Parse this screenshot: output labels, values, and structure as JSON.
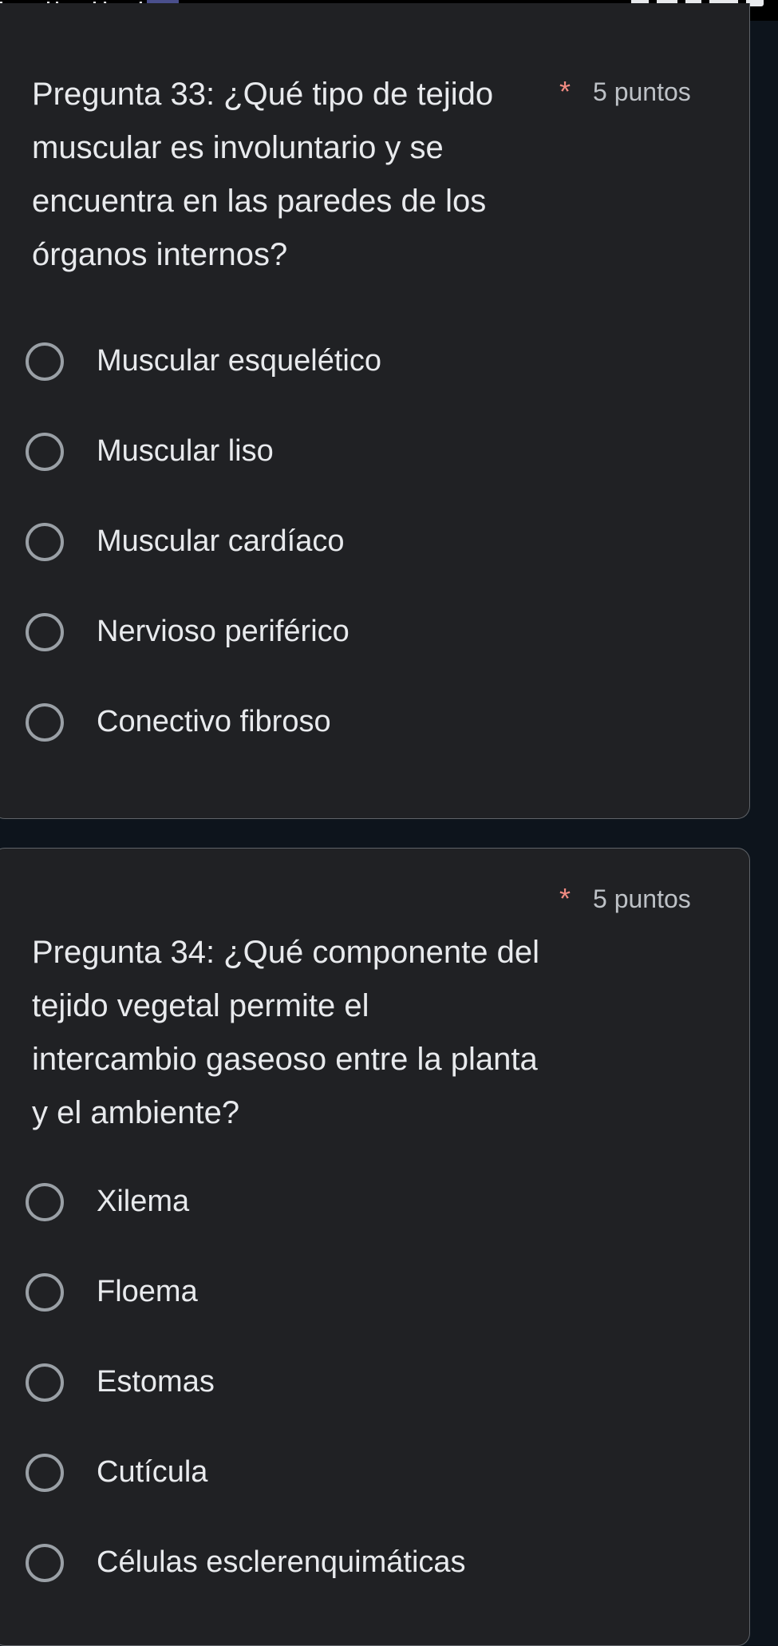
{
  "questions": [
    {
      "title": "Pregunta 33: ¿Qué tipo de tejido muscular es involuntario y se encuentra en las paredes de los órganos internos?",
      "required_mark": "*",
      "points": "5 puntos",
      "options": [
        "Muscular esquelético",
        "Muscular liso",
        "Muscular cardíaco",
        "Nervioso periférico",
        "Conectivo fibroso"
      ]
    },
    {
      "title": "Pregunta 34: ¿Qué componente del tejido vegetal permite el intercambio gaseoso entre la planta y el ambiente?",
      "required_mark": "*",
      "points": "5 puntos",
      "options": [
        "Xilema",
        "Floema",
        "Estomas",
        "Cutícula",
        "Células esclerenquimáticas"
      ]
    }
  ],
  "colors": {
    "page_background": "#0d141c",
    "card_background": "#202124",
    "card_border": "#5f6368",
    "text": "#e8eaed",
    "required": "#f28b82",
    "radio_outline": "#9aa0a6"
  }
}
